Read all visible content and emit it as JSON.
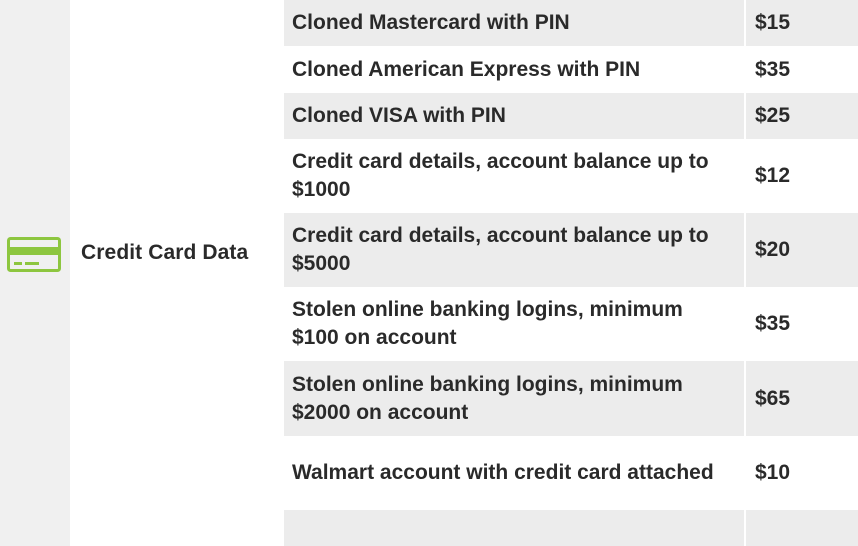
{
  "category": {
    "icon": "credit-card-icon",
    "icon_color": "#8dc63f",
    "label": "Credit Card Data"
  },
  "items": [
    {
      "description": "Cloned Mastercard with PIN",
      "price": "$15"
    },
    {
      "description": "Cloned American Express with PIN",
      "price": "$35"
    },
    {
      "description": "Cloned VISA with PIN",
      "price": "$25"
    },
    {
      "description": "Credit card details, account balance up to $1000",
      "price": "$12"
    },
    {
      "description": "Credit card details, account balance up to $5000",
      "price": "$20"
    },
    {
      "description": "Stolen online banking logins, minimum $100 on account",
      "price": "$35"
    },
    {
      "description": "Stolen online banking logins, minimum $2000 on account",
      "price": "$65"
    },
    {
      "description": "Walmart account with credit card attached",
      "price": "$10"
    },
    {
      "description": "",
      "price": ""
    }
  ]
}
